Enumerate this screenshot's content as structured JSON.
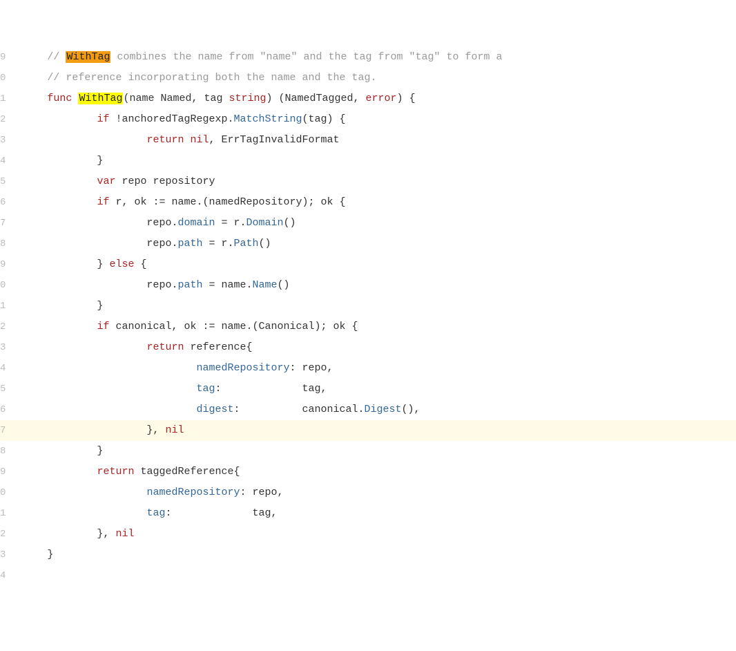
{
  "lines": [
    {
      "num": "9",
      "hl": false,
      "tokens": [
        {
          "cls": "c-plain",
          "txt": "    "
        },
        {
          "cls": "c-comment",
          "txt": "// "
        },
        {
          "cls": "c-comment hl-orange",
          "txt": "WithTag"
        },
        {
          "cls": "c-comment",
          "txt": " combines the name from \"name\" and the tag from \"tag\" to form a"
        }
      ]
    },
    {
      "num": "0",
      "hl": false,
      "tokens": [
        {
          "cls": "c-plain",
          "txt": "    "
        },
        {
          "cls": "c-comment",
          "txt": "// reference incorporating both the name and the tag."
        }
      ]
    },
    {
      "num": "1",
      "hl": false,
      "tokens": [
        {
          "cls": "c-plain",
          "txt": "    "
        },
        {
          "cls": "c-keyword",
          "txt": "func"
        },
        {
          "cls": "c-plain",
          "txt": " "
        },
        {
          "cls": "c-func hl-yellow",
          "txt": "WithTag"
        },
        {
          "cls": "c-plain",
          "txt": "(name Named, tag "
        },
        {
          "cls": "c-keyword",
          "txt": "string"
        },
        {
          "cls": "c-plain",
          "txt": ") (NamedTagged, "
        },
        {
          "cls": "c-keyword",
          "txt": "error"
        },
        {
          "cls": "c-plain",
          "txt": ") {"
        }
      ]
    },
    {
      "num": "2",
      "hl": false,
      "tokens": [
        {
          "cls": "c-plain",
          "txt": "            "
        },
        {
          "cls": "c-keyword",
          "txt": "if"
        },
        {
          "cls": "c-plain",
          "txt": " !anchoredTagRegexp."
        },
        {
          "cls": "c-ident",
          "txt": "MatchString"
        },
        {
          "cls": "c-plain",
          "txt": "(tag) {"
        }
      ]
    },
    {
      "num": "3",
      "hl": false,
      "tokens": [
        {
          "cls": "c-plain",
          "txt": "                    "
        },
        {
          "cls": "c-keyword",
          "txt": "return"
        },
        {
          "cls": "c-plain",
          "txt": " "
        },
        {
          "cls": "c-keyword",
          "txt": "nil"
        },
        {
          "cls": "c-plain",
          "txt": ", ErrTagInvalidFormat"
        }
      ]
    },
    {
      "num": "4",
      "hl": false,
      "tokens": [
        {
          "cls": "c-plain",
          "txt": "            }"
        }
      ]
    },
    {
      "num": "5",
      "hl": false,
      "tokens": [
        {
          "cls": "c-plain",
          "txt": "            "
        },
        {
          "cls": "c-keyword",
          "txt": "var"
        },
        {
          "cls": "c-plain",
          "txt": " repo repository"
        }
      ]
    },
    {
      "num": "6",
      "hl": false,
      "tokens": [
        {
          "cls": "c-plain",
          "txt": "            "
        },
        {
          "cls": "c-keyword",
          "txt": "if"
        },
        {
          "cls": "c-plain",
          "txt": " r, ok := name.(namedRepository); ok {"
        }
      ]
    },
    {
      "num": "7",
      "hl": false,
      "tokens": [
        {
          "cls": "c-plain",
          "txt": "                    repo."
        },
        {
          "cls": "c-ident",
          "txt": "domain"
        },
        {
          "cls": "c-plain",
          "txt": " = r."
        },
        {
          "cls": "c-ident",
          "txt": "Domain"
        },
        {
          "cls": "c-plain",
          "txt": "()"
        }
      ]
    },
    {
      "num": "8",
      "hl": false,
      "tokens": [
        {
          "cls": "c-plain",
          "txt": "                    repo."
        },
        {
          "cls": "c-ident",
          "txt": "path"
        },
        {
          "cls": "c-plain",
          "txt": " = r."
        },
        {
          "cls": "c-ident",
          "txt": "Path"
        },
        {
          "cls": "c-plain",
          "txt": "()"
        }
      ]
    },
    {
      "num": "9",
      "hl": false,
      "tokens": [
        {
          "cls": "c-plain",
          "txt": "            } "
        },
        {
          "cls": "c-keyword",
          "txt": "else"
        },
        {
          "cls": "c-plain",
          "txt": " {"
        }
      ]
    },
    {
      "num": "0",
      "hl": false,
      "tokens": [
        {
          "cls": "c-plain",
          "txt": "                    repo."
        },
        {
          "cls": "c-ident",
          "txt": "path"
        },
        {
          "cls": "c-plain",
          "txt": " = name."
        },
        {
          "cls": "c-ident",
          "txt": "Name"
        },
        {
          "cls": "c-plain",
          "txt": "()"
        }
      ]
    },
    {
      "num": "1",
      "hl": false,
      "tokens": [
        {
          "cls": "c-plain",
          "txt": "            }"
        }
      ]
    },
    {
      "num": "2",
      "hl": false,
      "tokens": [
        {
          "cls": "c-plain",
          "txt": "            "
        },
        {
          "cls": "c-keyword",
          "txt": "if"
        },
        {
          "cls": "c-plain",
          "txt": " canonical, ok := name.(Canonical); ok {"
        }
      ]
    },
    {
      "num": "3",
      "hl": false,
      "tokens": [
        {
          "cls": "c-plain",
          "txt": "                    "
        },
        {
          "cls": "c-keyword",
          "txt": "return"
        },
        {
          "cls": "c-plain",
          "txt": " reference{"
        }
      ]
    },
    {
      "num": "4",
      "hl": false,
      "tokens": [
        {
          "cls": "c-plain",
          "txt": "                            "
        },
        {
          "cls": "c-ident",
          "txt": "namedRepository"
        },
        {
          "cls": "c-plain",
          "txt": ": repo,"
        }
      ]
    },
    {
      "num": "5",
      "hl": false,
      "tokens": [
        {
          "cls": "c-plain",
          "txt": "                            "
        },
        {
          "cls": "c-ident",
          "txt": "tag"
        },
        {
          "cls": "c-plain",
          "txt": ":             tag,"
        }
      ]
    },
    {
      "num": "6",
      "hl": false,
      "tokens": [
        {
          "cls": "c-plain",
          "txt": "                            "
        },
        {
          "cls": "c-ident",
          "txt": "digest"
        },
        {
          "cls": "c-plain",
          "txt": ":          canonical."
        },
        {
          "cls": "c-ident",
          "txt": "Digest"
        },
        {
          "cls": "c-plain",
          "txt": "(),"
        }
      ]
    },
    {
      "num": "7",
      "hl": true,
      "tokens": [
        {
          "cls": "c-plain",
          "txt": "                    }, "
        },
        {
          "cls": "c-keyword",
          "txt": "nil"
        }
      ]
    },
    {
      "num": "8",
      "hl": false,
      "tokens": [
        {
          "cls": "c-plain",
          "txt": "            }"
        }
      ]
    },
    {
      "num": "9",
      "hl": false,
      "tokens": [
        {
          "cls": "c-plain",
          "txt": "            "
        },
        {
          "cls": "c-keyword",
          "txt": "return"
        },
        {
          "cls": "c-plain",
          "txt": " taggedReference{"
        }
      ]
    },
    {
      "num": "0",
      "hl": false,
      "tokens": [
        {
          "cls": "c-plain",
          "txt": "                    "
        },
        {
          "cls": "c-ident",
          "txt": "namedRepository"
        },
        {
          "cls": "c-plain",
          "txt": ": repo,"
        }
      ]
    },
    {
      "num": "1",
      "hl": false,
      "tokens": [
        {
          "cls": "c-plain",
          "txt": "                    "
        },
        {
          "cls": "c-ident",
          "txt": "tag"
        },
        {
          "cls": "c-plain",
          "txt": ":             tag,"
        }
      ]
    },
    {
      "num": "2",
      "hl": false,
      "tokens": [
        {
          "cls": "c-plain",
          "txt": "            }, "
        },
        {
          "cls": "c-keyword",
          "txt": "nil"
        }
      ]
    },
    {
      "num": "3",
      "hl": false,
      "tokens": [
        {
          "cls": "c-plain",
          "txt": "    }"
        }
      ]
    },
    {
      "num": "4",
      "hl": false,
      "tokens": [
        {
          "cls": "c-plain",
          "txt": ""
        }
      ]
    }
  ]
}
